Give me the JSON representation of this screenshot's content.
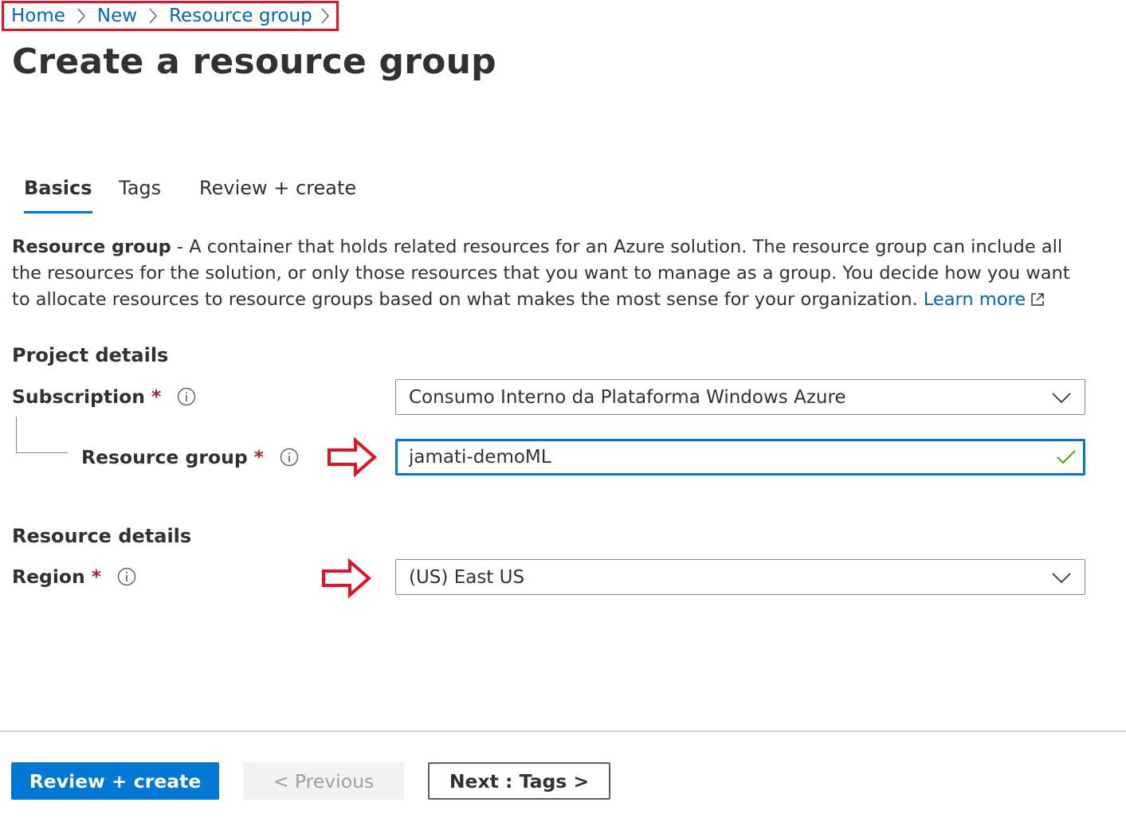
{
  "breadcrumb": {
    "items": [
      "Home",
      "New",
      "Resource group"
    ]
  },
  "page": {
    "title": "Create a resource group"
  },
  "tabs": [
    {
      "label": "Basics",
      "active": true
    },
    {
      "label": "Tags",
      "active": false
    },
    {
      "label": "Review + create",
      "active": false
    }
  ],
  "description": {
    "bold_prefix": "Resource group",
    "text": " - A container that holds related resources for an Azure solution. The resource group can include all the resources for the solution, or only those resources that you want to manage as a group. You decide how you want to allocate resources to resource groups based on what makes the most sense for your organization. ",
    "link_label": "Learn more"
  },
  "project_details": {
    "heading": "Project details",
    "subscription": {
      "label": "Subscription",
      "required_mark": "*",
      "value": "Consumo Interno da Plataforma Windows Azure"
    },
    "resource_group": {
      "label": "Resource group",
      "required_mark": "*",
      "value": "jamati-demoML",
      "valid": true
    }
  },
  "resource_details": {
    "heading": "Resource details",
    "region": {
      "label": "Region",
      "required_mark": "*",
      "value": "(US) East US"
    }
  },
  "footer": {
    "review_create_label": "Review + create",
    "previous_label": "< Previous",
    "next_label": "Next : Tags >"
  },
  "colors": {
    "link_blue": "#0067b8",
    "primary_blue": "#0078d4",
    "annotation_red": "#e81123",
    "required_red": "#a4262c",
    "valid_green": "#57a300"
  },
  "icons": [
    "chevron-right-icon",
    "external-link-icon",
    "info-icon",
    "chevron-down-icon",
    "checkmark-icon",
    "red-arrow-annotation-icon"
  ]
}
